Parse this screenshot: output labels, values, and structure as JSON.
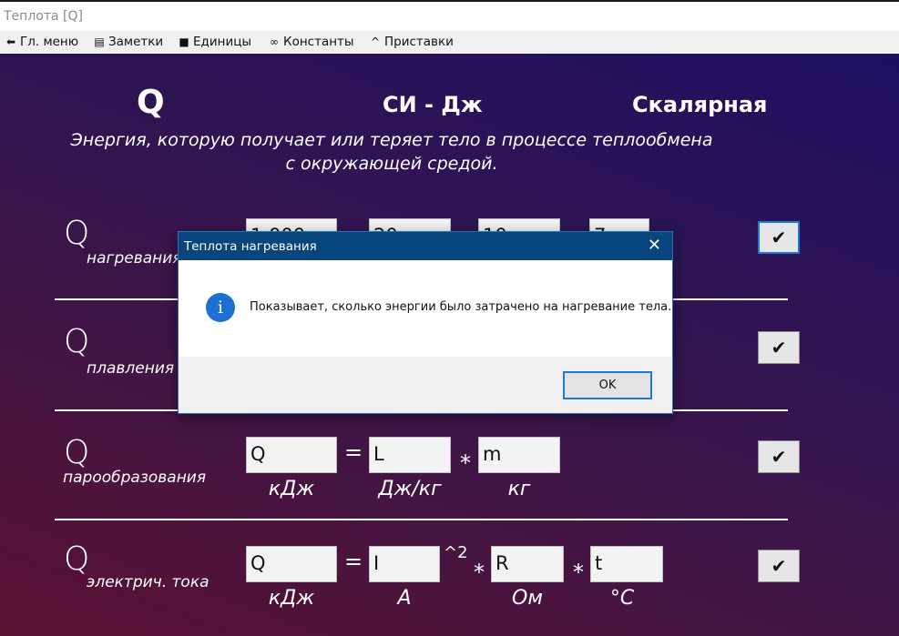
{
  "window": {
    "title": "Теплота [Q]"
  },
  "menu": [
    {
      "label": "Гл. меню",
      "icon": "back-arrow-icon"
    },
    {
      "label": "Заметки",
      "icon": "notes-icon"
    },
    {
      "label": "Единицы",
      "icon": "book-icon"
    },
    {
      "label": "Константы",
      "icon": "link-icon"
    },
    {
      "label": "Приставки",
      "icon": "caret-up-icon"
    }
  ],
  "header": {
    "symbol": "Q",
    "unit": "СИ - Дж",
    "type": "Скалярная",
    "description_line1": "Энергия, которую получает или теряет тело в процессе теплообмена",
    "description_line2": "с окружающей средой."
  },
  "formulas": {
    "q_symbol": "Q",
    "heating": {
      "sub": "нагревания",
      "v1": "1 000",
      "v2": "20",
      "v3": "10",
      "v4": "7"
    },
    "melting": {
      "sub": "плавления"
    },
    "vapor": {
      "sub": "парообразования",
      "f1": "Q",
      "eq": "=",
      "f2": "L",
      "mul": "*",
      "f3": "m",
      "u1": "кДж",
      "u2": "Дж/кг",
      "u3": "кг"
    },
    "electric": {
      "sub": "электрич. тока",
      "f1": "Q",
      "eq": "=",
      "f2": "I",
      "pow": "^2",
      "mul1": "*",
      "f3": "R",
      "mul2": "*",
      "f4": "t",
      "u1": "кДж",
      "u2": "А",
      "u3": "Ом",
      "u4": "°С"
    },
    "check_glyph": "✔"
  },
  "dialog": {
    "title": "Теплота нагревания",
    "close": "✕",
    "icon_glyph": "i",
    "message": "Показывает, сколько энергии было затрачено на нагревание тела.",
    "ok_label": "OK"
  }
}
